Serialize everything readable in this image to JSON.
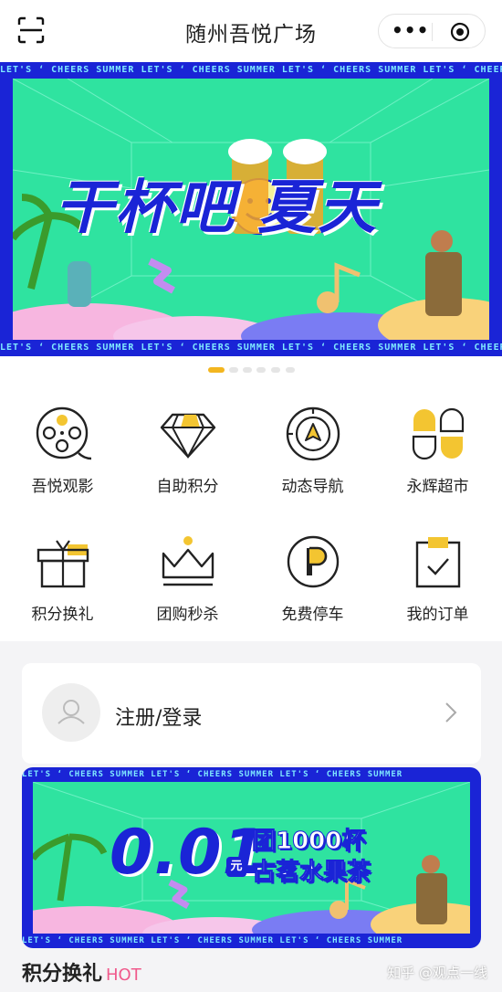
{
  "header": {
    "title": "随州吾悦广场",
    "scan_icon": "scan-icon",
    "more_icon": "more-dots-icon",
    "close_icon": "target-icon",
    "more_label": "•••"
  },
  "banner": {
    "strip_text": "LET'S ‘ CHEERS SUMMER   LET'S ‘ CHEERS SUMMER   LET'S ‘ CHEERS SUMMER   LET'S ‘ CHEERS SUMMER",
    "headline": "干杯吧 夏天",
    "page_count": 6,
    "active_index": 0,
    "colors": {
      "frame": "#1a24d6",
      "field": "#2fe3a0",
      "strip_text": "#7fe9ff"
    }
  },
  "menu": {
    "items": [
      {
        "label": "吾悦观影",
        "icon": "film-reel-icon"
      },
      {
        "label": "自助积分",
        "icon": "diamond-icon"
      },
      {
        "label": "动态导航",
        "icon": "navigation-icon"
      },
      {
        "label": "永辉超市",
        "icon": "clover-icon"
      },
      {
        "label": "积分换礼",
        "icon": "gift-icon"
      },
      {
        "label": "团购秒杀",
        "icon": "crown-icon"
      },
      {
        "label": "免费停车",
        "icon": "parking-icon"
      },
      {
        "label": "我的订单",
        "icon": "order-icon"
      }
    ]
  },
  "login": {
    "label": "注册/登录",
    "avatar_icon": "user-avatar-icon",
    "chevron_icon": "chevron-right-icon"
  },
  "promo": {
    "strip_text": "LET'S ‘ CHEERS SUMMER   LET'S ‘ CHEERS SUMMER   LET'S ‘ CHEERS SUMMER",
    "price": "0.01",
    "unit": "元",
    "line1": "团1000杯",
    "line2": "古茗水果茶"
  },
  "section": {
    "title": "积分换礼",
    "badge": "HOT"
  },
  "watermark": "知乎 @观点一线",
  "colors": {
    "accent": "#f3b61f",
    "hot": "#f05a8c"
  }
}
